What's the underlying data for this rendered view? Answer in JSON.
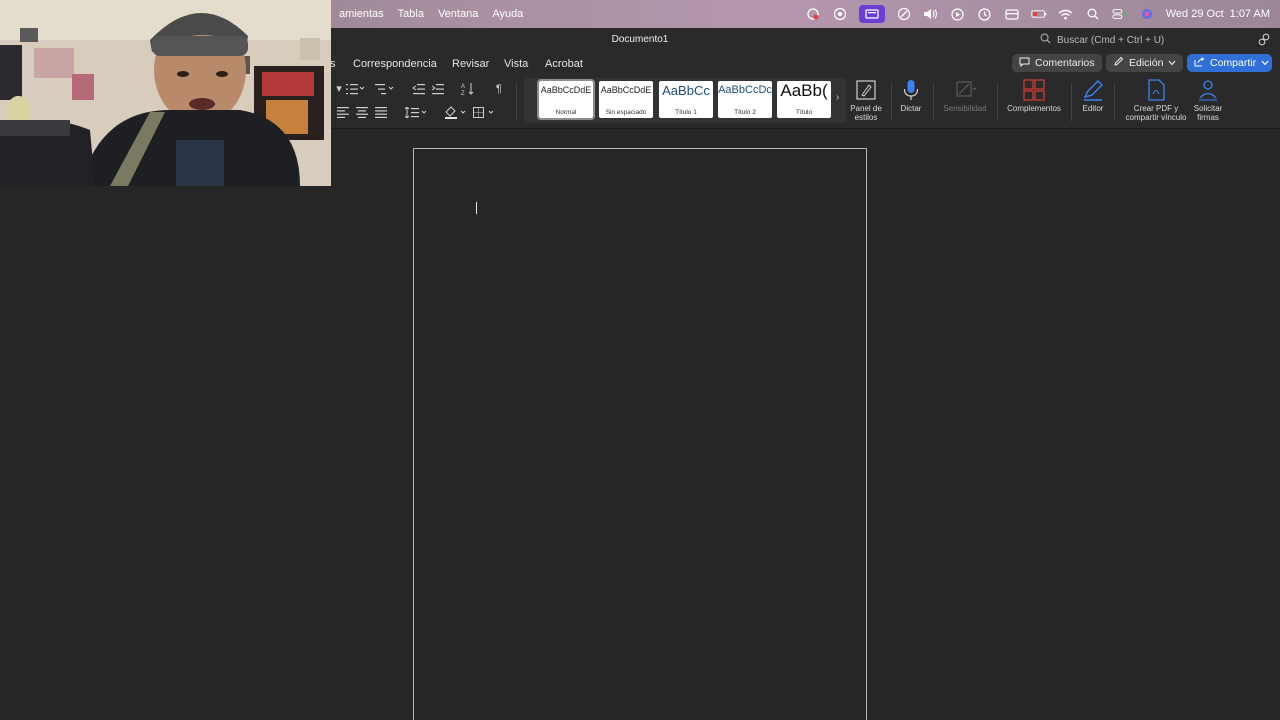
{
  "menubar": {
    "menus": [
      "amientas",
      "Tabla",
      "Ventana",
      "Ayuda"
    ],
    "date": "Wed 29 Oct",
    "time": "1:07 AM"
  },
  "window": {
    "title": "Documento1",
    "search_placeholder": "Buscar (Cmd + Ctrl + U)"
  },
  "tabs": [
    "s",
    "Correspondencia",
    "Revisar",
    "Vista",
    "Acrobat"
  ],
  "actions": {
    "comments": "Comentarios",
    "editing": "Edición",
    "share": "Compartir"
  },
  "styles": [
    {
      "sample": "AaBbCcDdE",
      "name": "Normal"
    },
    {
      "sample": "AaBbCcDdE",
      "name": "Sin espaciado"
    },
    {
      "sample": "AaBbCc",
      "name": "Título 1"
    },
    {
      "sample": "AaBbCcDc",
      "name": "Título 2"
    },
    {
      "sample": "AaBb(",
      "name": "Título"
    }
  ],
  "ribbon": {
    "styles_pane": [
      "Panel de",
      "estilos"
    ],
    "dictate": "Dictar",
    "sensitivity": "Sensibilidad",
    "addins": "Complementos",
    "editor": "Editor",
    "create_pdf": [
      "Crear PDF y",
      "compartir vínculo"
    ],
    "request_signatures": [
      "Solicitar",
      "firmas"
    ]
  },
  "colors": {
    "accent": "#2f6fd6",
    "background": "#262626",
    "ribbon": "#2a2a2a",
    "addins_red": "#c23b32"
  }
}
